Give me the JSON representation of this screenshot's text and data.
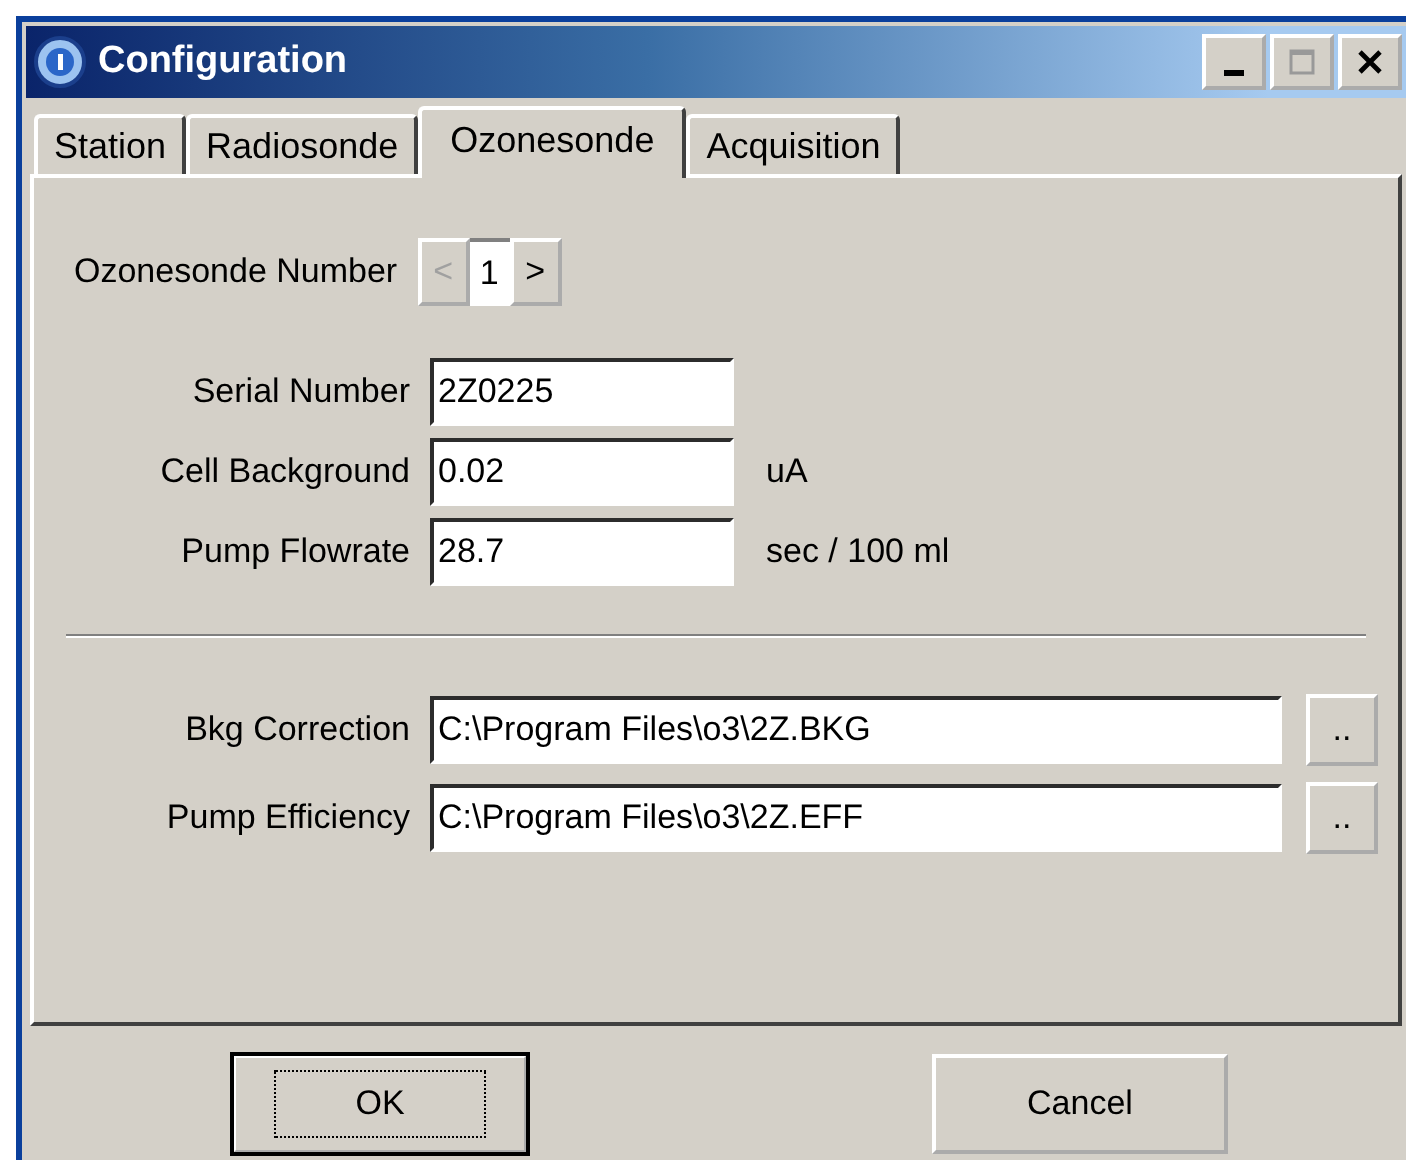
{
  "window": {
    "title": "Configuration"
  },
  "tabs": [
    {
      "label": "Station",
      "selected": false
    },
    {
      "label": "Radiosonde",
      "selected": false
    },
    {
      "label": "Ozonesonde",
      "selected": true
    },
    {
      "label": "Acquisition",
      "selected": false
    }
  ],
  "ozonesonde_number": {
    "label": "Ozonesonde Number",
    "prev": "<",
    "value": "1",
    "next": ">",
    "prev_disabled": true,
    "next_disabled": false
  },
  "fields": [
    {
      "label": "Serial Number",
      "value": "2Z0225"
    },
    {
      "label": "Cell Background",
      "value": "0.02",
      "unit": "uA"
    },
    {
      "label": "Pump Flowrate",
      "value": "28.7",
      "unit": "sec / 100 ml"
    }
  ],
  "files": [
    {
      "label": "Bkg Correction",
      "value": "C:\\Program Files\\o3\\2Z.BKG",
      "browse": ".."
    },
    {
      "label": "Pump Efficiency",
      "value": "C:\\Program Files\\o3\\2Z.EFF",
      "browse": ".."
    }
  ],
  "buttons": [
    {
      "label": "OK",
      "focused": true
    },
    {
      "label": "Cancel",
      "focused": false
    }
  ]
}
